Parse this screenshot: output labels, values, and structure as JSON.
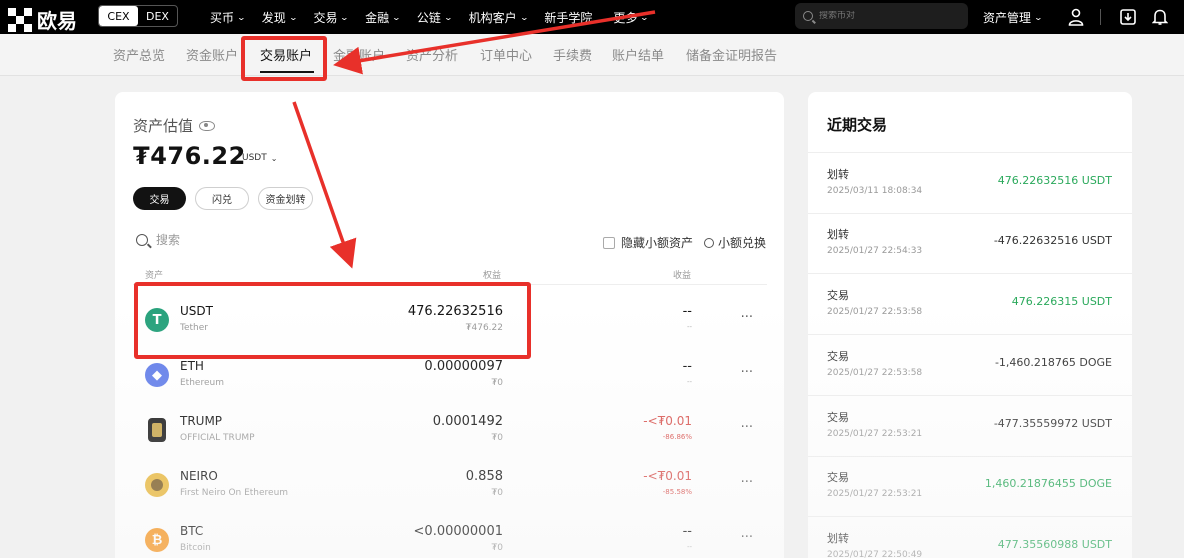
{
  "topbar": {
    "logo_text": "欧易",
    "cex_label": "CEX",
    "dex_label": "DEX",
    "nav": [
      {
        "label": "买币",
        "chevron": "⌄"
      },
      {
        "label": "发现",
        "chevron": "⌄"
      },
      {
        "label": "交易",
        "chevron": "⌄"
      },
      {
        "label": "金融",
        "chevron": "⌄"
      },
      {
        "label": "公链",
        "chevron": "⌄"
      },
      {
        "label": "机构客户",
        "chevron": "⌄"
      },
      {
        "label": "新手学院",
        "chevron": ""
      },
      {
        "label": "更多",
        "chevron": "⌄"
      }
    ],
    "search_placeholder": "搜索币对",
    "asset_mgmt_label": "资产管理",
    "icons": [
      "user-icon",
      "download-icon",
      "bell-icon"
    ]
  },
  "subnav": {
    "items": [
      "资产总览",
      "资金账户",
      "交易账户",
      "金融账户",
      "资产分析",
      "订单中心",
      "手续费",
      "账户结单",
      "储备金证明报告"
    ],
    "active": "交易账户"
  },
  "asset": {
    "est_label": "资产估值",
    "balance": "₮476.22",
    "currency": "USDT",
    "buttons": [
      "交易",
      "闪兑",
      "资金划转"
    ],
    "search_placeholder": "搜索",
    "hide_small_label": "隐藏小额资产",
    "small_exchange_label": "小额兑换",
    "columns": {
      "asset": "资产",
      "equity": "权益",
      "pnl": "收益"
    },
    "rows": [
      {
        "symbol": "USDT",
        "name": "Tether",
        "amount": "476.22632516",
        "value": "₮476.22",
        "pnl": "--",
        "pnl_pct": "--",
        "more": "...",
        "pnl_color": "neutral"
      },
      {
        "symbol": "ETH",
        "name": "Ethereum",
        "amount": "0.00000097",
        "value": "₮0",
        "pnl": "--",
        "pnl_pct": "--",
        "more": "...",
        "pnl_color": "neutral"
      },
      {
        "symbol": "TRUMP",
        "name": "OFFICIAL TRUMP",
        "amount": "0.0001492",
        "value": "₮0",
        "pnl": "-<₮0.01",
        "pnl_pct": "-86.86%",
        "more": "...",
        "pnl_color": "red"
      },
      {
        "symbol": "NEIRO",
        "name": "First Neiro On Ethereum",
        "amount": "0.858",
        "value": "₮0",
        "pnl": "-<₮0.01",
        "pnl_pct": "-85.58%",
        "more": "...",
        "pnl_color": "red"
      },
      {
        "symbol": "BTC",
        "name": "Bitcoin",
        "amount": "<0.00000001",
        "value": "₮0",
        "pnl": "--",
        "pnl_pct": "--",
        "more": "...",
        "pnl_color": "neutral"
      }
    ]
  },
  "recent": {
    "title": "近期交易",
    "items": [
      {
        "type": "划转",
        "time": "2025/03/11 18:08:34",
        "amount": "476.22632516 USDT",
        "color": "green"
      },
      {
        "type": "划转",
        "time": "2025/01/27 22:54:33",
        "amount": "-476.22632516 USDT",
        "color": "neutral"
      },
      {
        "type": "交易",
        "time": "2025/01/27 22:53:58",
        "amount": "476.226315 USDT",
        "color": "green"
      },
      {
        "type": "交易",
        "time": "2025/01/27 22:53:58",
        "amount": "-1,460.218765 DOGE",
        "color": "neutral"
      },
      {
        "type": "交易",
        "time": "2025/01/27 22:53:21",
        "amount": "-477.35559972 USDT",
        "color": "neutral"
      },
      {
        "type": "交易",
        "time": "2025/01/27 22:53:21",
        "amount": "1,460.21876455 DOGE",
        "color": "green"
      },
      {
        "type": "划转",
        "time": "2025/01/27 22:50:49",
        "amount": "477.35560988 USDT",
        "color": "green"
      }
    ]
  },
  "colors": {
    "accent_red": "#e8302a",
    "green": "#2aa95b",
    "loss_red": "#d9534f",
    "usdt": "#26a17b",
    "eth": "#627eea",
    "btc": "#f7931a"
  }
}
